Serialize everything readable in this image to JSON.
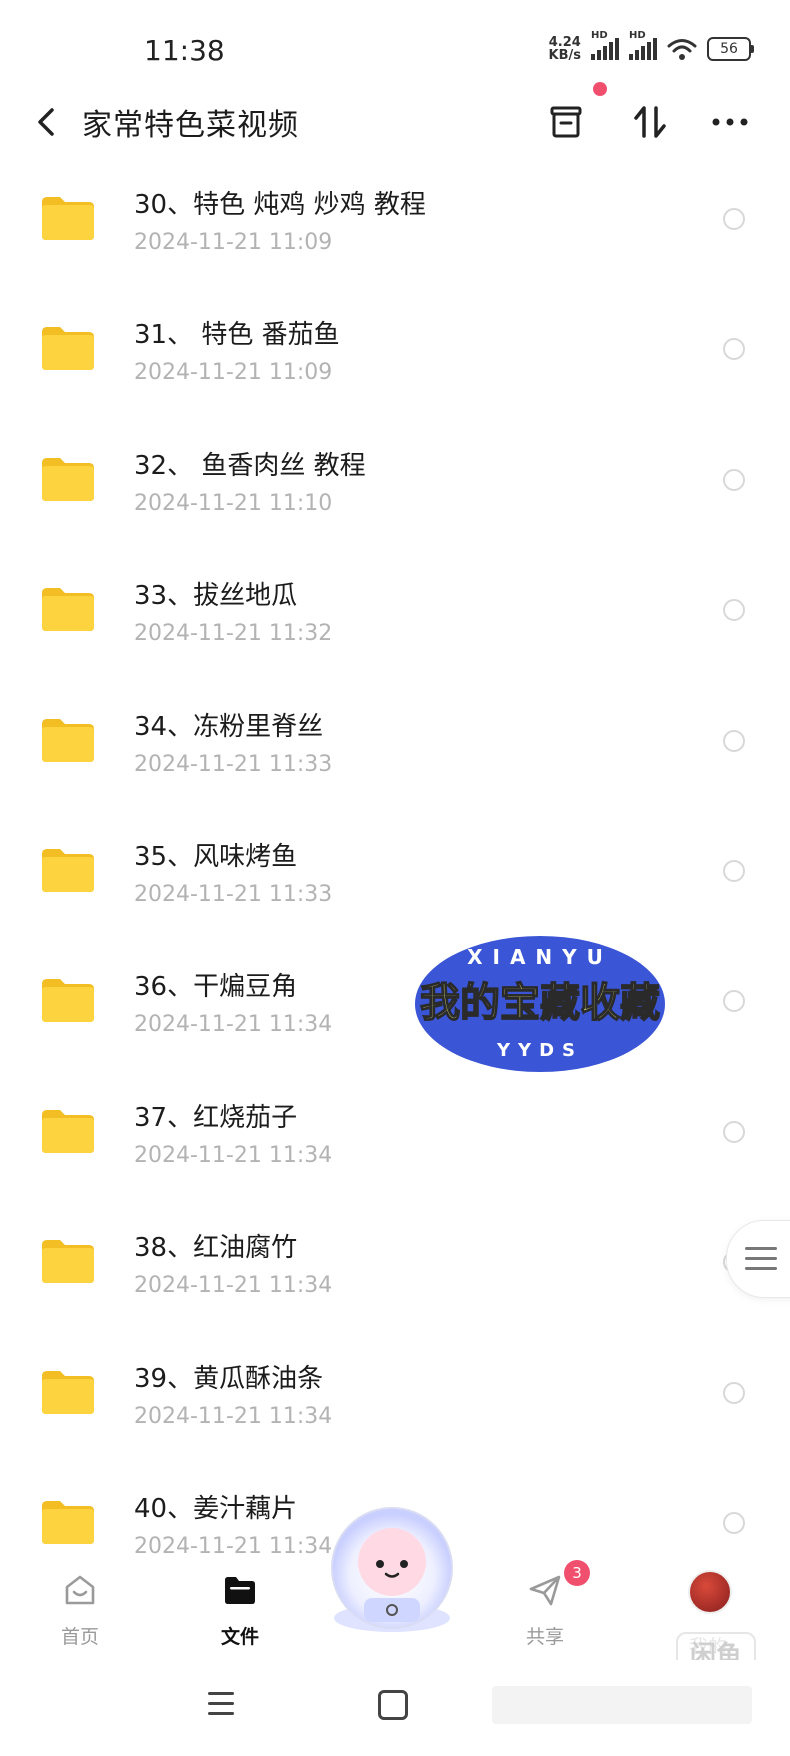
{
  "status_bar": {
    "time": "11:38",
    "net_speed_value": "4.24",
    "net_speed_unit": "KB/s",
    "sim1_label": "HD",
    "sim2_label": "HD",
    "battery": "56"
  },
  "header": {
    "title": "家常特色菜视频"
  },
  "files": [
    {
      "name": "30、特色 炖鸡 炒鸡 教程",
      "date": "2024-11-21  11:09"
    },
    {
      "name": "31、 特色 番茄鱼",
      "date": "2024-11-21  11:09"
    },
    {
      "name": "32、 鱼香肉丝 教程",
      "date": "2024-11-21  11:10"
    },
    {
      "name": "33、拔丝地瓜",
      "date": "2024-11-21  11:32"
    },
    {
      "name": "34、冻粉里脊丝",
      "date": "2024-11-21  11:33"
    },
    {
      "name": "35、风味烤鱼",
      "date": "2024-11-21  11:33"
    },
    {
      "name": "36、干煸豆角",
      "date": "2024-11-21  11:34"
    },
    {
      "name": "37、红烧茄子",
      "date": "2024-11-21  11:34"
    },
    {
      "name": "38、红油腐竹",
      "date": "2024-11-21  11:34"
    },
    {
      "name": "39、黄瓜酥油条",
      "date": "2024-11-21  11:34"
    },
    {
      "name": "40、姜汁藕片",
      "date": "2024-11-21  11:34"
    }
  ],
  "badge": {
    "top_text": "XIANYU",
    "main_text": "我的宝藏收藏",
    "bottom_text": "YYDS"
  },
  "tabs": {
    "home": "首页",
    "files": "文件",
    "share": "共享",
    "me": "我的",
    "share_count": "3"
  },
  "watermark": "闲鱼",
  "colors": {
    "folder": "#fdd43f",
    "accent_dot": "#f0506e",
    "badge_blue": "#3a55d6",
    "badge_text": "#e8f27a"
  }
}
